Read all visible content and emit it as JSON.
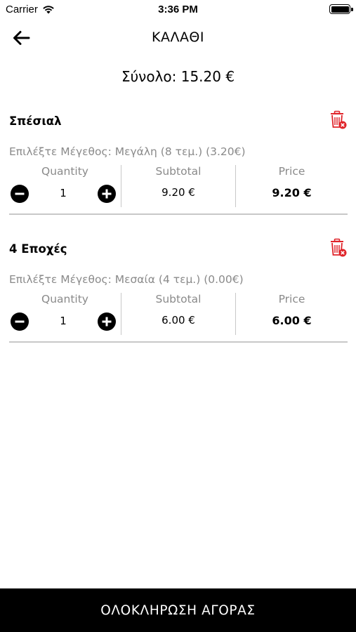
{
  "status_bar": {
    "carrier": "Carrier",
    "time": "3:36 PM",
    "battery_level": 1.0
  },
  "nav": {
    "title": "ΚΑΛΑΘΙ"
  },
  "cart": {
    "total": "Σύνολο: 15.20 €"
  },
  "columns": {
    "quantity": "Quantity",
    "subtotal": "Subtotal",
    "price": "Price"
  },
  "items": [
    {
      "name": "Σπέσιαλ",
      "option": "Επιλέξτε Μέγεθος: Μεγάλη (8 τεμ.)  (3.20€)",
      "quantity": "1",
      "subtotal": "9.20 €",
      "price": "9.20 €"
    },
    {
      "name": "4 Εποχές",
      "option": "Επιλέξτε Μέγεθος: Μεσαία (4 τεμ.)  (0.00€)",
      "quantity": "1",
      "subtotal": "6.00 €",
      "price": "6.00 €"
    }
  ],
  "checkout": {
    "label": "ΟΛΟΚΛΗΡΩΣΗ ΑΓΟΡΑΣ"
  },
  "colors": {
    "delete": "#e0242a",
    "text_muted": "#8a8a8a",
    "checkout_bg": "#000000"
  }
}
